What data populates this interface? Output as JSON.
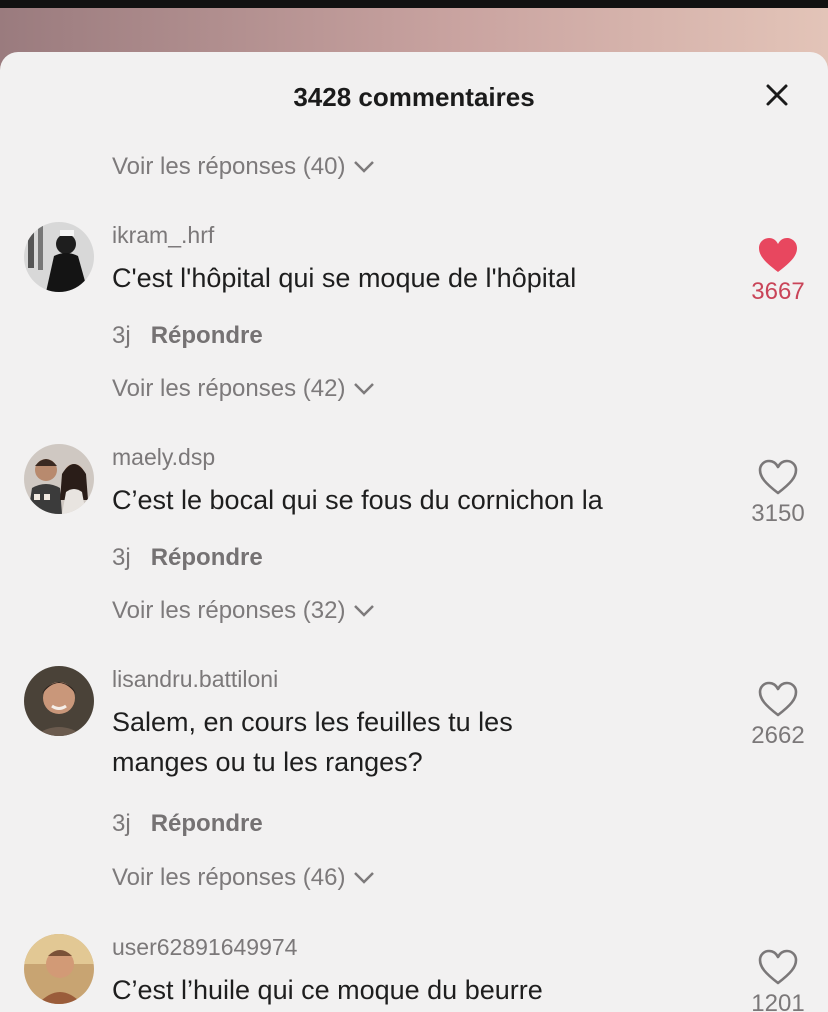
{
  "header": {
    "title": "3428 commentaires"
  },
  "replies_toggles": [
    "Voir les réponses (40)",
    "Voir les réponses (42)",
    "Voir les réponses (32)",
    "Voir les réponses (46)"
  ],
  "comments": [
    {
      "username": "ikram_.hrf",
      "text": "C'est l'hôpital qui se moque de l'hôpital",
      "age": "3j",
      "reply_label": "Répondre",
      "likes": "3667",
      "liked": true
    },
    {
      "username": "maely.dsp",
      "text": "C’est le bocal qui se fous du cornichon la",
      "age": "3j",
      "reply_label": "Répondre",
      "likes": "3150",
      "liked": false
    },
    {
      "username": "lisandru.battiloni",
      "text": "Salem, en cours les feuilles tu les manges ou tu les ranges?",
      "age": "3j",
      "reply_label": "Répondre",
      "likes": "2662",
      "liked": false
    },
    {
      "username": "user62891649974",
      "text": "C’est l’huile qui ce moque du beurre",
      "likes": "1201",
      "liked": false
    }
  ],
  "colors": {
    "liked_heart": "#e8475f",
    "liked_count": "#c94458",
    "muted_text": "#7b7879",
    "sheet_bg": "#f2f1f1"
  },
  "icons": [
    "close-icon",
    "chevron-down-icon",
    "heart-filled-icon",
    "heart-outline-icon"
  ]
}
